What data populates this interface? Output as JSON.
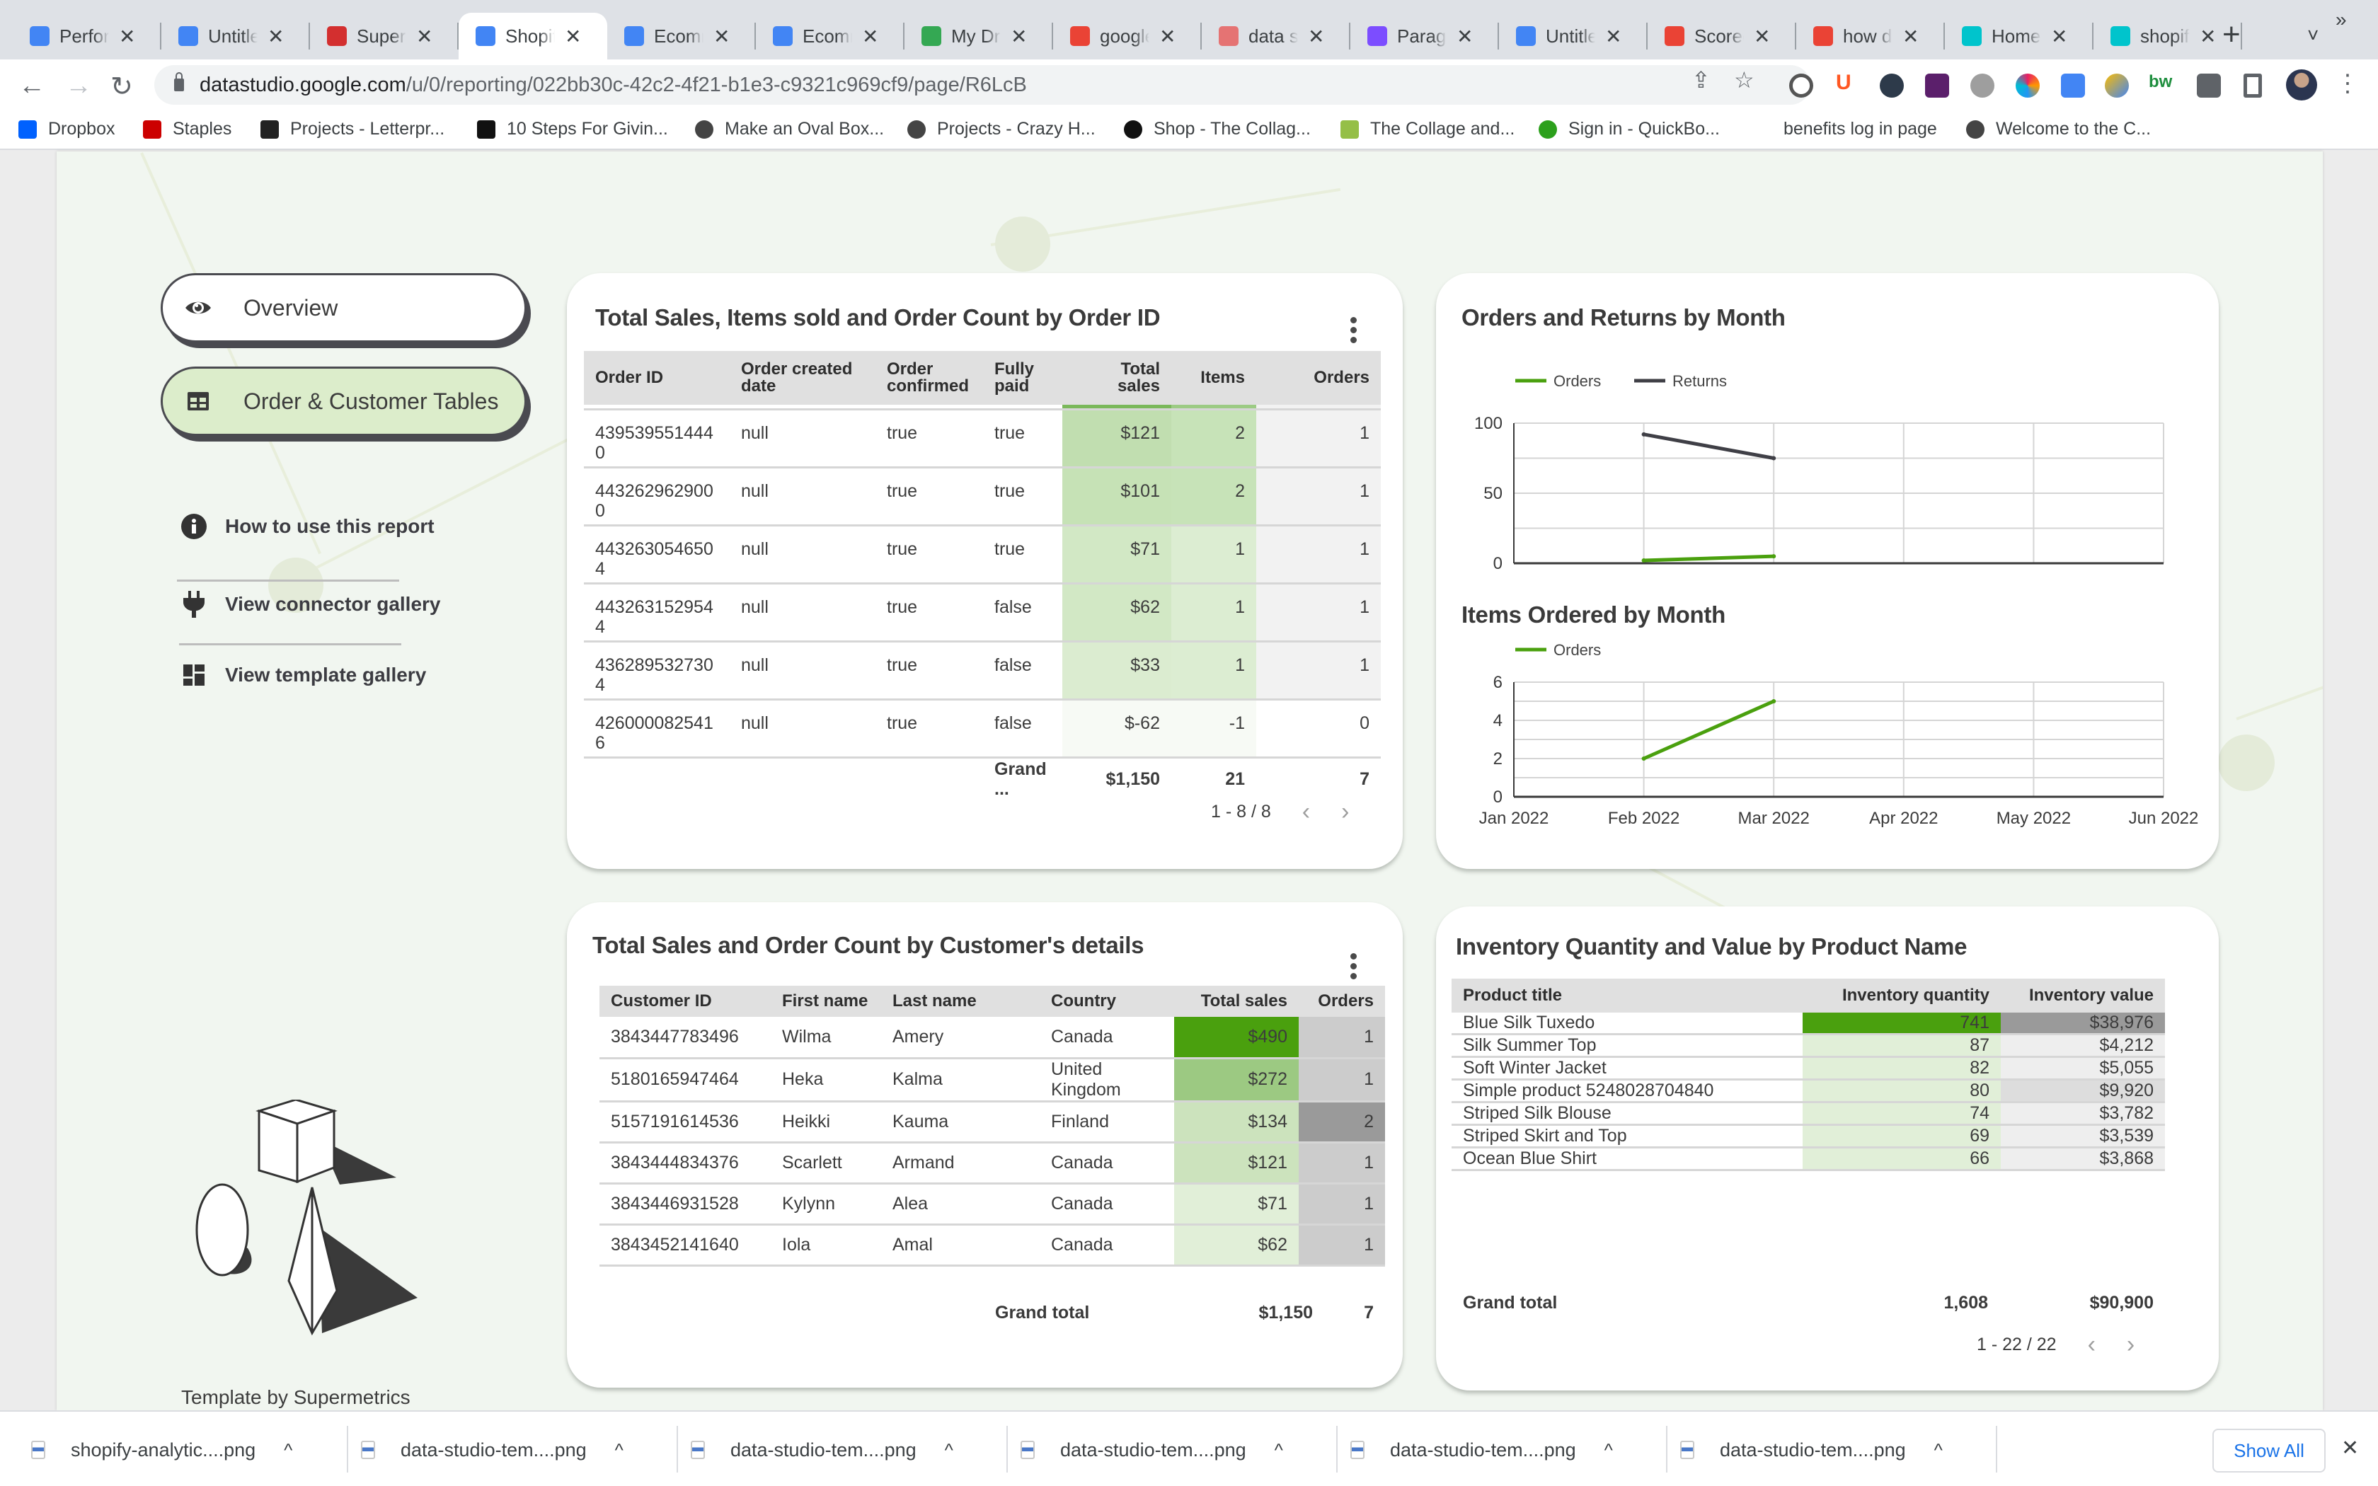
{
  "browser": {
    "tabs": [
      {
        "title": "Performance",
        "icon": "analytics-icon",
        "color": "#4285f4",
        "active": false
      },
      {
        "title": "Untitled",
        "icon": "data-studio-icon",
        "color": "#4285f4",
        "active": false
      },
      {
        "title": "Supermetrics",
        "icon": "supermetrics-icon",
        "color": "#d32f2f",
        "active": false
      },
      {
        "title": "Shopify",
        "icon": "data-studio-icon",
        "color": "#4285f4",
        "active": true
      },
      {
        "title": "Ecommerce",
        "icon": "data-studio-icon",
        "color": "#4285f4",
        "active": false
      },
      {
        "title": "Ecommerce",
        "icon": "data-studio-icon",
        "color": "#4285f4",
        "active": false
      },
      {
        "title": "My Drive",
        "icon": "google-drive-icon",
        "color": "#34a853",
        "active": false
      },
      {
        "title": "google",
        "icon": "google-icon",
        "color": "#ea4335",
        "active": false
      },
      {
        "title": "data studio",
        "icon": "data-studio-pink-icon",
        "color": "#e57373",
        "active": false
      },
      {
        "title": "Paragraph",
        "icon": "paragraph-icon",
        "color": "#7c4dff",
        "active": false
      },
      {
        "title": "Untitled",
        "icon": "data-studio-icon",
        "color": "#4285f4",
        "active": false
      },
      {
        "title": "Scorecard",
        "icon": "google-icon",
        "color": "#ea4335",
        "active": false
      },
      {
        "title": "how do",
        "icon": "google-icon",
        "color": "#ea4335",
        "active": false
      },
      {
        "title": "Home",
        "icon": "canva-icon",
        "color": "#00c4cc",
        "active": false
      },
      {
        "title": "shopify",
        "icon": "canva-icon",
        "color": "#00c4cc",
        "active": false
      }
    ],
    "new_tab": "+",
    "tab_list": "˅",
    "close_glyph": "✕",
    "url_host": "datastudio.google.com",
    "url_path": "/u/0/reporting/022bb30c-42c2-4f21-b1e3-c9321c969cf9/page/R6LcB",
    "bookmarks": [
      {
        "label": "Dropbox",
        "icon": "dropbox-icon",
        "color": "#0061fe"
      },
      {
        "label": "Staples",
        "icon": "staples-icon",
        "color": "#cc0000"
      },
      {
        "label": "Projects - Letterpr...",
        "icon": "letterpress-icon",
        "color": "#222222"
      },
      {
        "label": "10 Steps For Givin...",
        "icon": "f-icon",
        "color": "#111111"
      },
      {
        "label": "Make an Oval Box...",
        "icon": "globe-icon",
        "color": "#444444"
      },
      {
        "label": "Projects - Crazy H...",
        "icon": "globe-icon",
        "color": "#444444"
      },
      {
        "label": "Shop - The Collag...",
        "icon": "collage-icon",
        "color": "#111111"
      },
      {
        "label": "The Collage and...",
        "icon": "shopify-icon",
        "color": "#95bf47"
      },
      {
        "label": "Sign in - QuickBo...",
        "icon": "quickbooks-icon",
        "color": "#2ca01c"
      },
      {
        "label": "benefits log in page",
        "icon": "",
        "color": ""
      },
      {
        "label": "Welcome to the C...",
        "icon": "globe-icon",
        "color": "#444444"
      }
    ],
    "bookmarks_more": "»"
  },
  "report": {
    "nav": {
      "overview_label": "Overview",
      "tables_label": "Order & Customer Tables",
      "links": [
        {
          "label": "How to use this report",
          "icon": "info-icon"
        },
        {
          "label": "View connector gallery",
          "icon": "plug-icon"
        },
        {
          "label": "View template gallery",
          "icon": "template-grid-icon"
        }
      ]
    },
    "credit": "Template by Supermetrics",
    "colors": {
      "accent_green": "#4aa00e",
      "active_pill": "#dcedcb",
      "canvas_bg": "#f1f6f0"
    },
    "orders_table": {
      "title": "Total Sales, Items sold and Order Count by Order ID",
      "columns": [
        "Order ID",
        "Order created date",
        "Order confirmed",
        "Fully paid",
        "Total sales",
        "Items",
        "Orders"
      ],
      "rows": [
        [
          "4395395514440",
          "null",
          "true",
          "true",
          "$121",
          "2",
          "1"
        ],
        [
          "4432629629000",
          "null",
          "true",
          "true",
          "$101",
          "2",
          "1"
        ],
        [
          "4432630546504",
          "null",
          "true",
          "true",
          "$71",
          "1",
          "1"
        ],
        [
          "4432631529544",
          "null",
          "true",
          "false",
          "$62",
          "1",
          "1"
        ],
        [
          "4362895327304",
          "null",
          "true",
          "false",
          "$33",
          "1",
          "1"
        ],
        [
          "4260000825416",
          "null",
          "true",
          "false",
          "$-62",
          "-1",
          "0"
        ]
      ],
      "row_heat": [
        {
          "sales": "#c1deb0",
          "items": "#c7e3b8",
          "orders": "#f2f2f2"
        },
        {
          "sales": "#c6e2b6",
          "items": "#c7e3b8",
          "orders": "#f2f2f2"
        },
        {
          "sales": "#d2e8c5",
          "items": "#dcedd2",
          "orders": "#f2f2f2"
        },
        {
          "sales": "#d2e8c5",
          "items": "#dcedd2",
          "orders": "#f2f2f2"
        },
        {
          "sales": "#dbecd0",
          "items": "#dcedd2",
          "orders": "#f2f2f2"
        },
        {
          "sales": "#f7faf5",
          "items": "#f7faf5",
          "orders": "#ffffff"
        }
      ],
      "total_label": "Grand ...",
      "totals": [
        "$1,150",
        "21",
        "7"
      ],
      "pager": "1 - 8 / 8"
    },
    "orders_returns_chart": {
      "title": "Orders and Returns by Month"
    },
    "items_chart": {
      "title": "Items Ordered by Month"
    },
    "customer_table": {
      "title": "Total Sales and Order Count by Customer's details",
      "columns": [
        "Customer ID",
        "First name",
        "Last name",
        "Country",
        "Total sales",
        "Orders"
      ],
      "rows": [
        [
          "3843447783496",
          "Wilma",
          "Amery",
          "Canada",
          "$490",
          "1"
        ],
        [
          "5180165947464",
          "Heka",
          "Kalma",
          "United Kingdom",
          "$272",
          "1"
        ],
        [
          "5157191614536",
          "Heikki",
          "Kauma",
          "Finland",
          "$134",
          "2"
        ],
        [
          "3843444834376",
          "Scarlett",
          "Armand",
          "Canada",
          "$121",
          "1"
        ],
        [
          "3843446931528",
          "Kylynn",
          "Alea",
          "Canada",
          "$71",
          "1"
        ],
        [
          "3843452141640",
          "Iola",
          "Amal",
          "Canada",
          "$62",
          "1"
        ]
      ],
      "row_heat": [
        {
          "sales": "#4aa00e",
          "orders": "#cccccc"
        },
        {
          "sales": "#9cc982",
          "orders": "#cccccc"
        },
        {
          "sales": "#cce3bd",
          "orders": "#9a9a9a"
        },
        {
          "sales": "#cce3bd",
          "orders": "#cccccc"
        },
        {
          "sales": "#e1efd8",
          "orders": "#cccccc"
        },
        {
          "sales": "#e1efd8",
          "orders": "#cccccc"
        }
      ],
      "total_label": "Grand total",
      "totals": [
        "$1,150",
        "7"
      ]
    },
    "inventory_table": {
      "title": "Inventory Quantity and Value by Product Name",
      "columns": [
        "Product title",
        "Inventory quantity",
        "Inventory value"
      ],
      "rows": [
        [
          "Blue Silk Tuxedo",
          "741",
          "$38,976"
        ],
        [
          "Silk Summer Top",
          "87",
          "$4,212"
        ],
        [
          "Soft Winter Jacket",
          "82",
          "$5,055"
        ],
        [
          "Simple product 5248028704840",
          "80",
          "$9,920"
        ],
        [
          "Striped Silk Blouse",
          "74",
          "$3,782"
        ],
        [
          "Striped Skirt and Top",
          "69",
          "$3,539"
        ],
        [
          "Ocean Blue Shirt",
          "66",
          "$3,868"
        ]
      ],
      "row_heat": [
        {
          "qty": "#4aa00e",
          "val": "#9a9a9a"
        },
        {
          "qty": "#e1efd8",
          "val": "#eeeeee"
        },
        {
          "qty": "#e1efd8",
          "val": "#eeeeee"
        },
        {
          "qty": "#e1efd8",
          "val": "#dddddd"
        },
        {
          "qty": "#e1efd8",
          "val": "#eeeeee"
        },
        {
          "qty": "#e1efd8",
          "val": "#eeeeee"
        },
        {
          "qty": "#e1efd8",
          "val": "#eeeeee"
        }
      ],
      "total_label": "Grand total",
      "totals": [
        "1,608",
        "$90,900"
      ],
      "pager": "1 - 22 / 22"
    }
  },
  "downloads": {
    "items": [
      "shopify-analytic....png",
      "data-studio-tem....png",
      "data-studio-tem....png",
      "data-studio-tem....png",
      "data-studio-tem....png",
      "data-studio-tem....png"
    ],
    "show_all": "Show All",
    "close": "✕"
  },
  "chart_data": [
    {
      "type": "line",
      "title": "Orders and Returns by Month",
      "x": [
        "Jan 2022",
        "Feb 2022",
        "Mar 2022",
        "Apr 2022",
        "May 2022",
        "Jun 2022"
      ],
      "series": [
        {
          "name": "Orders",
          "color": "#4aa00e",
          "values": [
            null,
            2,
            5,
            null,
            null,
            null
          ]
        },
        {
          "name": "Returns",
          "color": "#3f3f46",
          "values": [
            null,
            92,
            75,
            null,
            null,
            null
          ]
        }
      ],
      "yticks": [
        0,
        50,
        100
      ],
      "ylim": [
        0,
        100
      ],
      "grid": true,
      "legend": "top-left"
    },
    {
      "type": "line",
      "title": "Items Ordered by Month",
      "x": [
        "Jan 2022",
        "Feb 2022",
        "Mar 2022",
        "Apr 2022",
        "May 2022",
        "Jun 2022"
      ],
      "series": [
        {
          "name": "Orders",
          "color": "#4aa00e",
          "values": [
            null,
            2,
            5,
            null,
            null,
            null
          ]
        }
      ],
      "yticks": [
        0,
        2,
        4,
        6
      ],
      "ylim": [
        0,
        6
      ],
      "grid": true,
      "legend": "top-left"
    }
  ]
}
